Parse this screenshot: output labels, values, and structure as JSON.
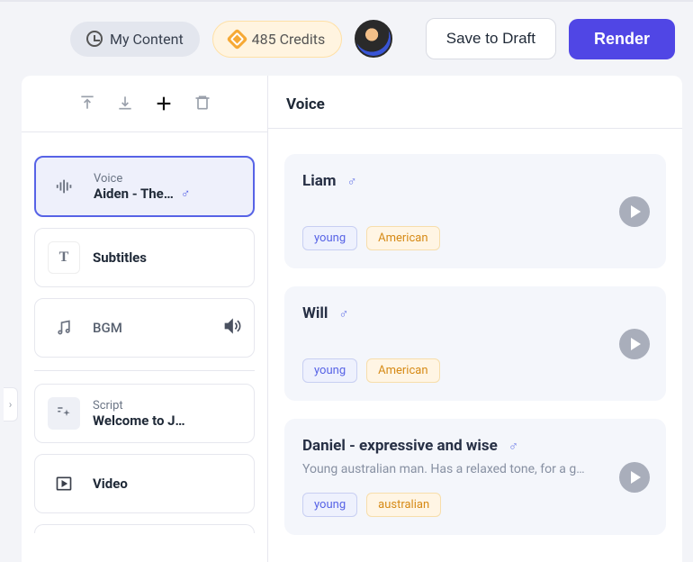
{
  "header": {
    "my_content": "My Content",
    "credits": "485 Credits",
    "save_draft": "Save to Draft",
    "render": "Render"
  },
  "sidebar": {
    "items": [
      {
        "section_label": "Voice",
        "main_label": "Aiden - The…",
        "selected": true,
        "icon": "waveform-icon",
        "trailing_gender": "♂"
      },
      {
        "main_label": "Subtitles",
        "icon": "text-icon"
      },
      {
        "main_label": "BGM",
        "icon": "music-icon",
        "trailing": "volume-icon"
      },
      {
        "section_label": "Script",
        "main_label": "Welcome to J…",
        "icon": "sparkle-icon"
      },
      {
        "main_label": "Video",
        "icon": "play-square-icon"
      }
    ]
  },
  "main": {
    "title": "Voice",
    "voices": [
      {
        "name": "Liam",
        "gender": "♂",
        "tags": [
          {
            "text": "young",
            "style": "blue"
          },
          {
            "text": "American",
            "style": "gold"
          }
        ]
      },
      {
        "name": "Will",
        "gender": "♂",
        "tags": [
          {
            "text": "young",
            "style": "blue"
          },
          {
            "text": "American",
            "style": "gold"
          }
        ]
      },
      {
        "name": "Daniel - expressive and wise",
        "gender": "♂",
        "desc": "Young australian man. Has a relaxed tone, for a g…",
        "tags": [
          {
            "text": "young",
            "style": "blue"
          },
          {
            "text": "australian",
            "style": "gold"
          }
        ]
      }
    ]
  }
}
